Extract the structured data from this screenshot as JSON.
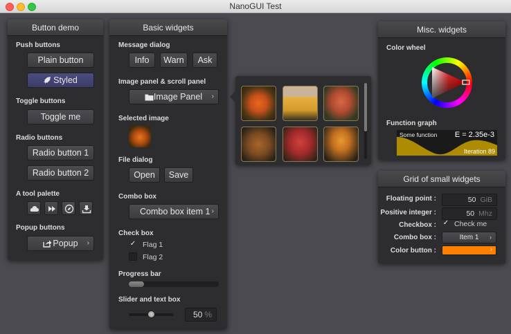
{
  "window": {
    "title": "NanoGUI Test"
  },
  "button_demo": {
    "title": "Button demo",
    "push_label": "Push buttons",
    "plain": "Plain button",
    "styled": "Styled",
    "toggle_label": "Toggle buttons",
    "toggle": "Toggle me",
    "radio_label": "Radio buttons",
    "radio1": "Radio button 1",
    "radio2": "Radio button 2",
    "palette_label": "A tool palette",
    "palette_icons": [
      "cloud-icon",
      "fast-forward-icon",
      "compass-icon",
      "install-icon"
    ],
    "popup_label": "Popup buttons",
    "popup": "Popup"
  },
  "basic_widgets": {
    "title": "Basic widgets",
    "message_label": "Message dialog",
    "info": "Info",
    "warn": "Warn",
    "ask": "Ask",
    "image_panel_label": "Image panel & scroll panel",
    "image_panel": "Image Panel",
    "selected_image_label": "Selected image",
    "file_label": "File dialog",
    "open": "Open",
    "save": "Save",
    "combo_label": "Combo box",
    "combo": "Combo box item 1",
    "checkbox_label": "Check box",
    "flag1": "Flag 1",
    "flag1_checked": true,
    "flag2": "Flag 2",
    "flag2_checked": false,
    "progress_label": "Progress bar",
    "progress": 0.17,
    "slider_label": "Slider and text box",
    "slider_value": 0.5,
    "slider_text": "50",
    "slider_unit": "%"
  },
  "misc_widgets": {
    "title": "Misc. widgets",
    "color_wheel_label": "Color wheel",
    "function_graph_label": "Function graph",
    "graph_caption": "Some function",
    "graph_header": "E = 2.35e-3",
    "graph_footer": "Iteration 89"
  },
  "grid": {
    "title": "Grid of small widgets",
    "float_label": "Floating point :",
    "float_value": "50",
    "float_unit": "GiB",
    "int_label": "Positive integer :",
    "int_value": "50",
    "int_unit": "Mhz",
    "check_label": "Checkbox :",
    "check_text": "Check me",
    "check_checked": true,
    "combo_label": "Combo box :",
    "combo_value": "Item 1",
    "color_label": "Color button :",
    "color_value": "#ff7f00"
  },
  "colors": {
    "accent": "#ff7f00",
    "graph_fill": "#c8a000"
  }
}
